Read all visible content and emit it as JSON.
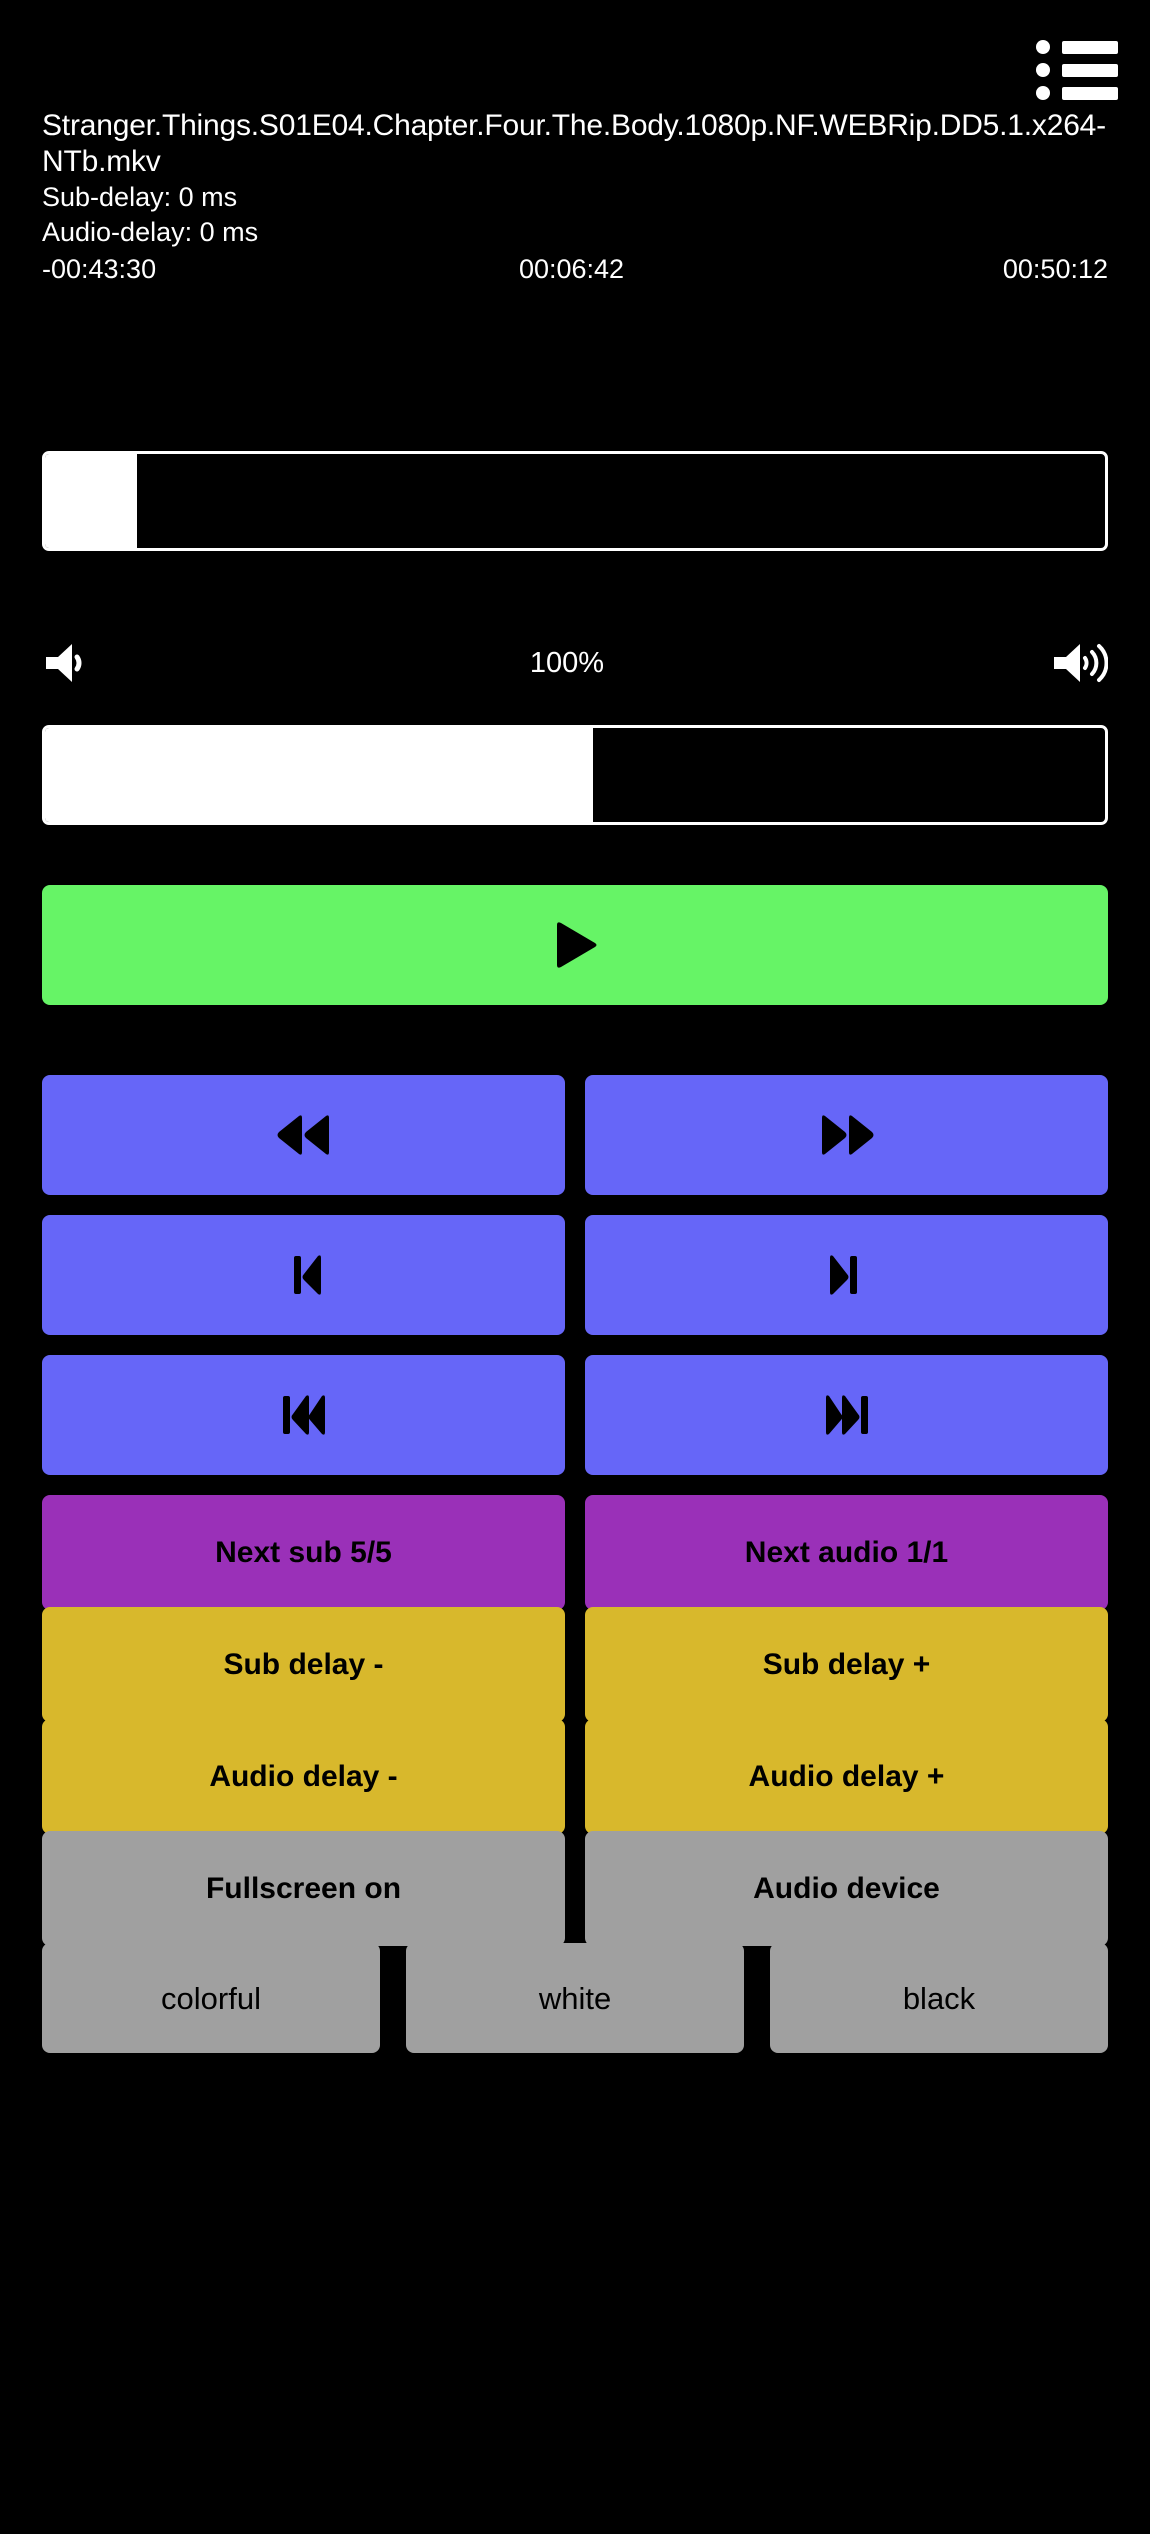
{
  "header": {
    "menu_icon": "list-menu-icon"
  },
  "info": {
    "filename": "Stranger.Things.S01E04.Chapter.Four.The.Body.1080p.NF.WEBRip.DD5.1.x264-NTb.mkv",
    "sub_delay": "Sub-delay: 0 ms",
    "audio_delay": "Audio-delay: 0 ms",
    "time_remaining": "-00:43:30",
    "time_current": "00:06:42",
    "time_total": "00:50:12"
  },
  "seek": {
    "name": "seek-slider",
    "progress_percent": 8.7
  },
  "volume": {
    "low_icon": "volume-low-icon",
    "high_icon": "volume-high-icon",
    "level_label": "100%",
    "level_percent": 51.7
  },
  "controls": {
    "play": {
      "label": "",
      "icon": "play-icon",
      "color": "#66f466"
    },
    "rewind": {
      "icon": "rewind-icon",
      "color": "#6666f8"
    },
    "fast_forward": {
      "icon": "fast-forward-icon",
      "color": "#6666f8"
    },
    "step_back": {
      "icon": "skip-to-start-icon",
      "color": "#6666f8"
    },
    "step_forward": {
      "icon": "skip-to-end-icon",
      "color": "#6666f8"
    },
    "previous": {
      "icon": "previous-track-icon",
      "color": "#6666f8"
    },
    "next": {
      "icon": "next-track-icon",
      "color": "#6666f8"
    }
  },
  "tracks": {
    "next_sub": "Next sub 5/5",
    "next_audio": "Next audio 1/1"
  },
  "delays": {
    "sub_minus": "Sub delay -",
    "sub_plus": "Sub delay +",
    "audio_minus": "Audio delay -",
    "audio_plus": "Audio delay +"
  },
  "options": {
    "fullscreen": "Fullscreen on",
    "audio_device": "Audio device"
  },
  "themes": {
    "colorful": "colorful",
    "white": "white",
    "black": "black"
  },
  "colors": {
    "background": "#000000",
    "play_green": "#66f466",
    "nav_blue": "#6666f8",
    "track_purple": "#9a30b8",
    "delay_yellow": "#d8b82c",
    "option_gray": "#a0a0a0",
    "text_white": "#ffffff"
  }
}
